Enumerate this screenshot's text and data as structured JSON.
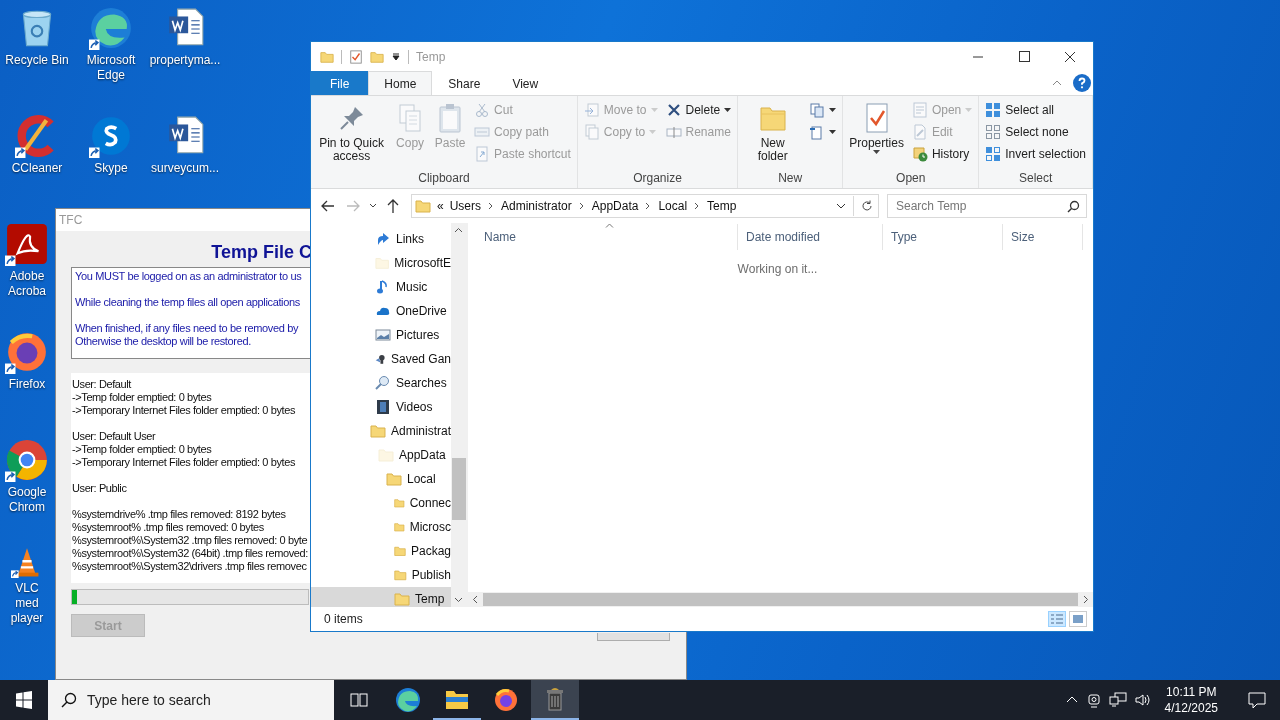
{
  "desktop": {
    "icon_columns": [
      [
        {
          "label": "Recycle Bin"
        },
        {
          "label": "CCleaner"
        },
        {
          "label": "Adobe Acroba"
        },
        {
          "label": "Firefox"
        },
        {
          "label": "Google Chrom"
        },
        {
          "label": "VLC med player"
        }
      ],
      [
        {
          "label": "Microsoft Edge"
        },
        {
          "label": "Skype"
        }
      ],
      [
        {
          "label": "propertyma..."
        },
        {
          "label": "surveycum..."
        }
      ]
    ]
  },
  "tfc_window": {
    "title": "TFC",
    "heading": "Temp File C",
    "notice": [
      "You MUST be logged on as an administrator to us",
      "While cleaning the temp files all open applications",
      "When finished, if any files need to be removed by\nOtherwise the desktop will be restored."
    ],
    "log": [
      "User: Default\n->Temp folder emptied: 0 bytes\n->Temporary Internet Files folder emptied: 0 bytes",
      "User: Default User\n->Temp folder emptied: 0 bytes\n->Temporary Internet Files folder emptied: 0 bytes",
      "User: Public",
      "%systemdrive% .tmp files removed: 8192 bytes\n%systemroot% .tmp files removed: 0 bytes\n%systemroot%\\System32 .tmp files removed: 0 byte\n%systemroot%\\System32 (64bit) .tmp files removed:\n%systemroot%\\System32\\drivers .tmp files removec"
    ],
    "progress": {
      "level": 0.02
    },
    "start_button": {
      "label": "Start",
      "disabled": true
    }
  },
  "explorer": {
    "title": "Temp",
    "tabs": [
      {
        "label": "File",
        "selected": false
      },
      {
        "label": "Home",
        "selected": true
      },
      {
        "label": "Share",
        "selected": false
      },
      {
        "label": "View",
        "selected": false
      }
    ],
    "ribbon": [
      {
        "label": "Clipboard",
        "columns": [
          [
            {
              "kind": "large",
              "label": "Pin to Quick access",
              "disabled": false,
              "dropdown": false
            }
          ],
          [
            {
              "kind": "large",
              "label": "Copy",
              "disabled": true,
              "dropdown": false
            }
          ],
          [
            {
              "kind": "large",
              "label": "Paste",
              "disabled": true,
              "dropdown": false
            }
          ],
          [
            {
              "kind": "small",
              "label": "Cut",
              "disabled": true,
              "dropdown": false
            },
            {
              "kind": "small",
              "label": "Copy path",
              "disabled": true,
              "dropdown": false
            },
            {
              "kind": "small",
              "label": "Paste shortcut",
              "disabled": true,
              "dropdown": false
            }
          ]
        ]
      },
      {
        "label": "Organize",
        "columns": [
          [
            {
              "kind": "small",
              "label": "Move to",
              "disabled": true,
              "dropdown": true
            },
            {
              "kind": "small",
              "label": "Copy to",
              "disabled": true,
              "dropdown": true
            }
          ],
          [
            {
              "kind": "small",
              "label": "Delete",
              "disabled": false,
              "dropdown": true
            },
            {
              "kind": "small",
              "label": "Rename",
              "disabled": true,
              "dropdown": false
            }
          ]
        ]
      },
      {
        "label": "New",
        "columns": [
          [
            {
              "kind": "large",
              "label": "New folder",
              "disabled": false,
              "dropdown": false
            }
          ],
          [
            {
              "kind": "small",
              "disabled": false,
              "dropdown": true
            },
            {
              "kind": "small",
              "disabled": false,
              "dropdown": true
            }
          ]
        ]
      },
      {
        "label": "Open",
        "columns": [
          [
            {
              "kind": "large",
              "label": "Properties",
              "disabled": false,
              "dropdown": true
            }
          ],
          [
            {
              "kind": "small",
              "label": "Open",
              "disabled": true,
              "dropdown": true
            },
            {
              "kind": "small",
              "label": "Edit",
              "disabled": true,
              "dropdown": false
            },
            {
              "kind": "small",
              "label": "History",
              "disabled": false,
              "dropdown": false
            }
          ]
        ]
      },
      {
        "label": "Select",
        "columns": [
          [
            {
              "kind": "small",
              "label": "Select all",
              "disabled": false,
              "dropdown": false
            },
            {
              "kind": "small",
              "label": "Select none",
              "disabled": false,
              "dropdown": false
            },
            {
              "kind": "small",
              "label": "Invert selection",
              "disabled": false,
              "dropdown": false
            }
          ]
        ]
      }
    ],
    "nav": {
      "forward_disabled": true
    },
    "breadcrumb": [
      "«",
      "Users",
      "Administrator",
      "AppData",
      "Local",
      "Temp"
    ],
    "search": {
      "placeholder": "Search Temp"
    },
    "tree": [
      {
        "label": "Links",
        "selected": false,
        "hidden": false
      },
      {
        "label": "MicrosoftE",
        "selected": false,
        "hidden": true
      },
      {
        "label": "Music",
        "selected": false,
        "hidden": false
      },
      {
        "label": "OneDrive",
        "selected": false,
        "hidden": false
      },
      {
        "label": "Pictures",
        "selected": false,
        "hidden": false
      },
      {
        "label": "Saved Gan",
        "selected": false,
        "hidden": false
      },
      {
        "label": "Searches",
        "selected": false,
        "hidden": false
      },
      {
        "label": "Videos",
        "selected": false,
        "hidden": false
      },
      {
        "label": "Administrat",
        "selected": false,
        "hidden": false,
        "children": [
          {
            "label": "AppData",
            "selected": false,
            "hidden": true,
            "children": [
              {
                "label": "Local",
                "selected": false,
                "hidden": false,
                "children": [
                  {
                    "label": "Connec",
                    "selected": false,
                    "hidden": false
                  },
                  {
                    "label": "Microsc",
                    "selected": false,
                    "hidden": false
                  },
                  {
                    "label": "Packag",
                    "selected": false,
                    "hidden": false
                  },
                  {
                    "label": "Publish",
                    "selected": false,
                    "hidden": false
                  },
                  {
                    "label": "Temp",
                    "selected": true,
                    "hidden": false
                  }
                ]
              }
            ]
          }
        ]
      }
    ],
    "columns": [
      "Name",
      "Date modified",
      "Type",
      "Size"
    ],
    "message": "Working on it...",
    "status": "0 items",
    "views": [
      {
        "selected": true
      },
      {
        "selected": false
      }
    ]
  },
  "taskbar": {
    "search": {
      "placeholder": "Type here to search"
    },
    "apps": [
      {
        "active": false,
        "running": false
      },
      {
        "active": false,
        "running": false
      },
      {
        "active": false,
        "running": true
      },
      {
        "active": false,
        "running": false
      },
      {
        "active": true,
        "running": true
      }
    ],
    "time": "10:11 PM",
    "date": "4/12/2025"
  }
}
